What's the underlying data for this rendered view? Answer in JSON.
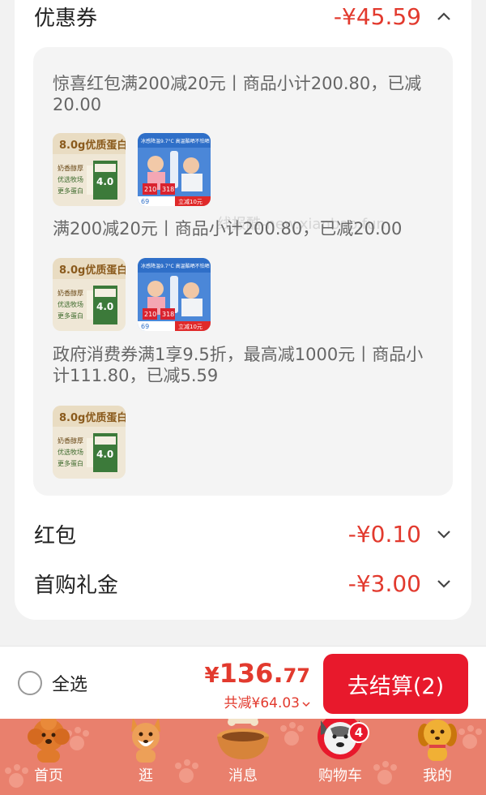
{
  "summary": {
    "coupon": {
      "title": "优惠券",
      "amount": "-¥45.59"
    },
    "red_packet": {
      "title": "红包",
      "amount": "-¥0.10"
    },
    "first_gift": {
      "title": "首购礼金",
      "amount": "-¥3.00"
    }
  },
  "coupon_details": [
    {
      "rule": "惊喜红包满200减20元丨商品小计200.80，已减20.00",
      "products": [
        "milk-product",
        "sunscreen-product"
      ]
    },
    {
      "rule": "满200减20元丨商品小计200.80，已减20.00",
      "products": [
        "milk-product",
        "sunscreen-product"
      ]
    },
    {
      "rule": "政府消费券满1享9.5折，最高减1000元丨商品小计111.80，已减5.59",
      "products": [
        "milk-product"
      ]
    }
  ],
  "product_text": {
    "milk_head": "8.0g优质蛋白",
    "milk_sub": "奶香醇厚",
    "milk_sub2": "优选牧场",
    "milk_sub3": "更多蛋白",
    "milk_num": "4.0",
    "spray_head": "冰感降温9.7°C 高温酷晒不怕晒",
    "spray_price1": "210",
    "spray_price2": "318",
    "spray_price3": "69",
    "spray_tag": "立减10元"
  },
  "watermark": "线报酷-new.xianbao.fun",
  "bottom": {
    "select_all": "全选",
    "total_symbol": "¥",
    "total_int": "136.",
    "total_dec": "77",
    "total_saved": "共减¥64.03",
    "checkout": "去结算(2)"
  },
  "tabs": [
    {
      "label": "首页",
      "icon": "poodle-dog-icon"
    },
    {
      "label": "逛",
      "icon": "corgi-dog-icon"
    },
    {
      "label": "消息",
      "icon": "dog-bowl-icon"
    },
    {
      "label": "购物车",
      "icon": "bulldog-icon",
      "badge": "4"
    },
    {
      "label": "我的",
      "icon": "golden-dog-icon"
    }
  ],
  "colors": {
    "accent": "#e8192c",
    "price": "#e23a2e",
    "tabbar": "#e9806d"
  }
}
